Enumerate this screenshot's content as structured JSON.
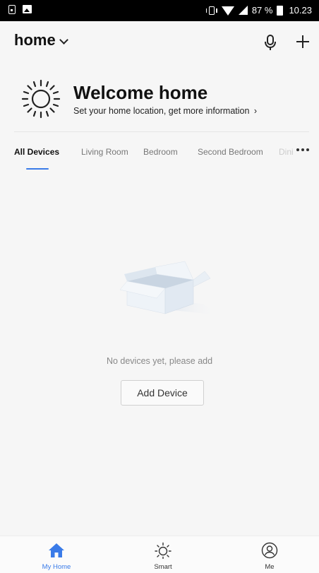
{
  "status_bar": {
    "battery": "87 %",
    "time": "10.23"
  },
  "header": {
    "home_title": "home"
  },
  "welcome": {
    "title": "Welcome home",
    "subtitle": "Set your home location, get more information"
  },
  "tabs": [
    {
      "label": "All Devices",
      "active": true
    },
    {
      "label": "Living Room",
      "active": false
    },
    {
      "label": "Bedroom",
      "active": false
    },
    {
      "label": "Second Bedroom",
      "active": false
    },
    {
      "label": "Dini",
      "active": false
    }
  ],
  "empty_state": {
    "message": "No devices yet, please add",
    "button_label": "Add Device"
  },
  "bottom_nav": [
    {
      "label": "My Home",
      "icon": "home-icon",
      "active": true
    },
    {
      "label": "Smart",
      "icon": "sun-icon",
      "active": false
    },
    {
      "label": "Me",
      "icon": "user-icon",
      "active": false
    }
  ],
  "colors": {
    "accent": "#3a7be8",
    "background": "#f6f6f6",
    "status_bar": "#000000"
  }
}
